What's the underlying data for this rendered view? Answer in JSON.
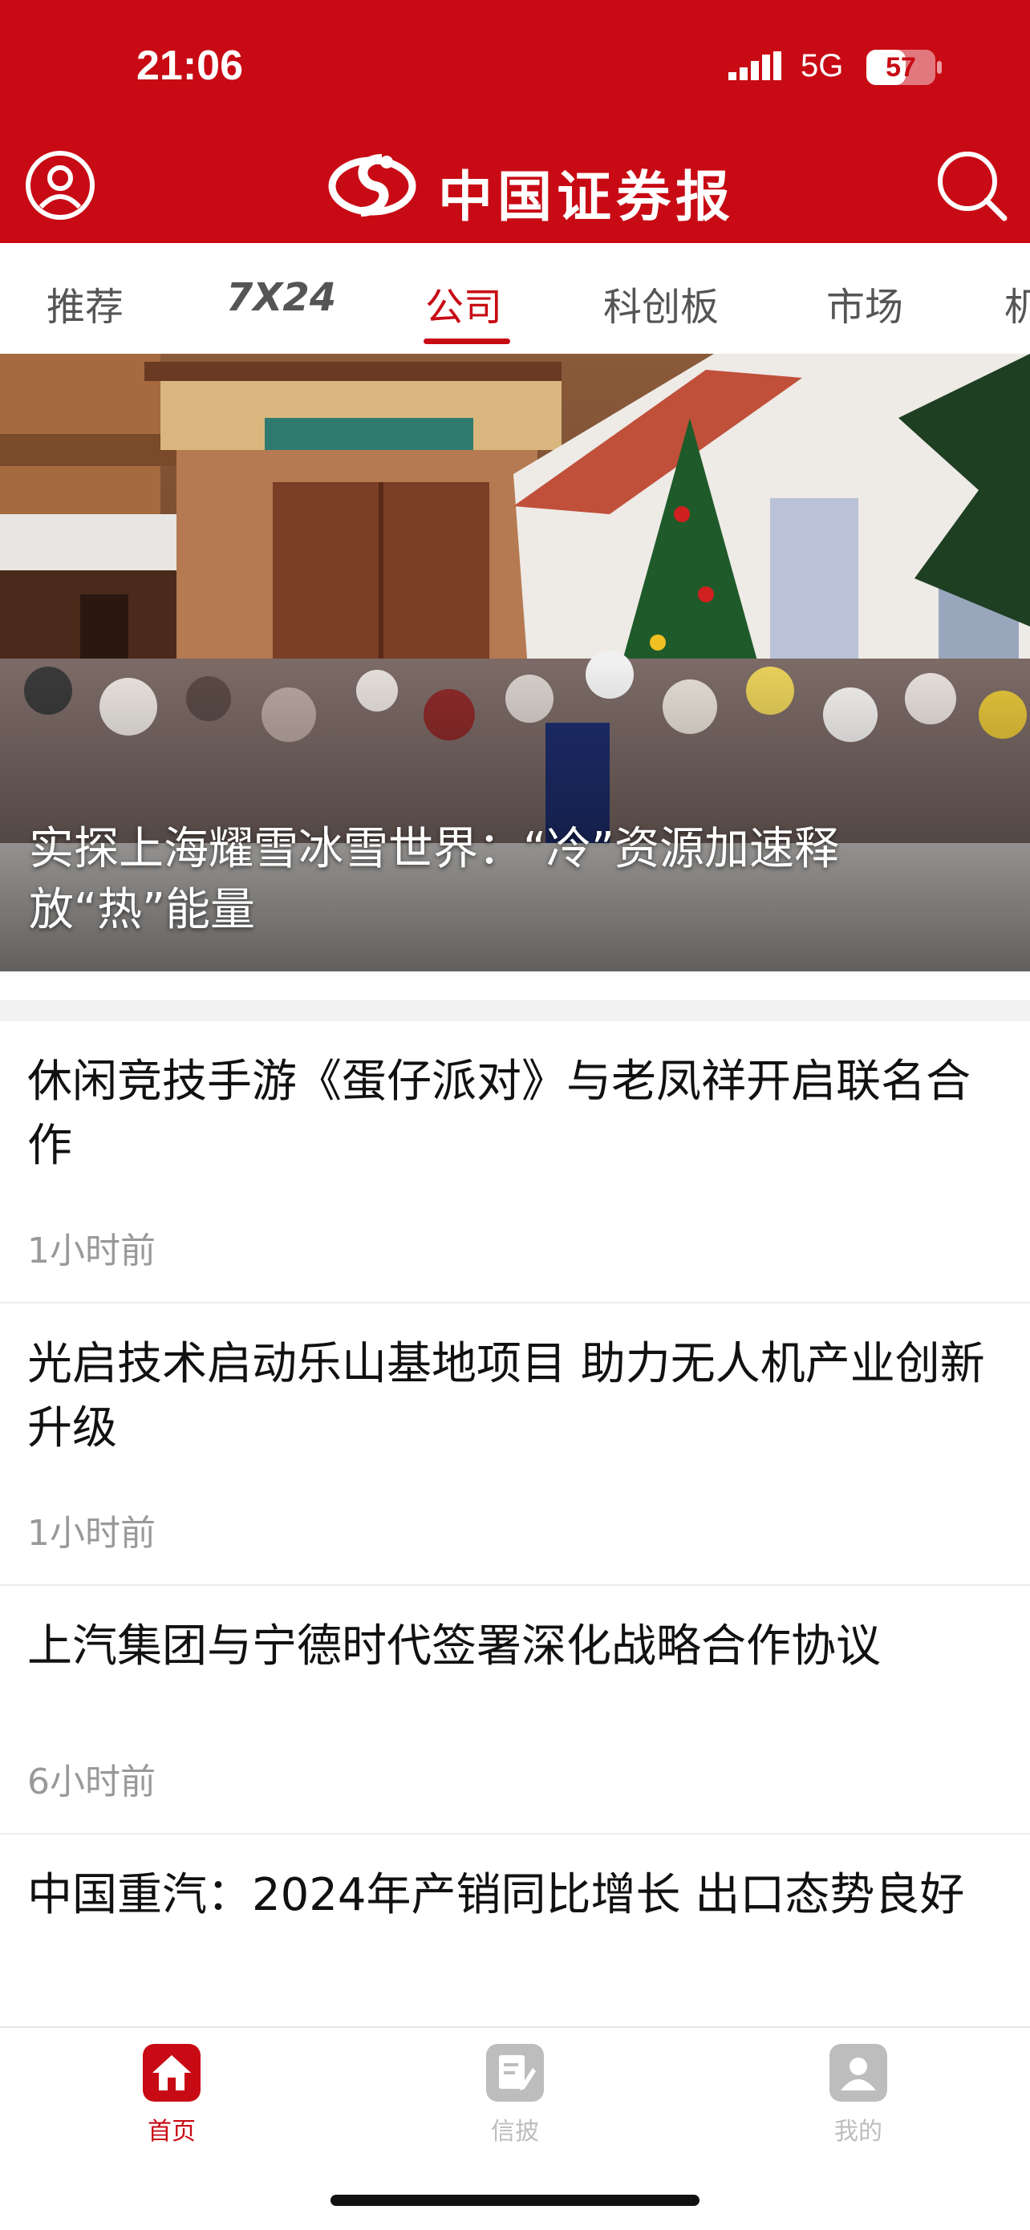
{
  "status_bar": {
    "time": "21:06",
    "network": "5G",
    "battery": "57",
    "battery_level": 0.57
  },
  "header": {
    "logo_text": "中国证券报"
  },
  "tabs": [
    {
      "label": "推荐",
      "active": false
    },
    {
      "label": "7X24",
      "active": false
    },
    {
      "label": "公司",
      "active": true
    },
    {
      "label": "科创板",
      "active": false
    },
    {
      "label": "市场",
      "active": false
    },
    {
      "label": "机",
      "active": false
    }
  ],
  "hero": {
    "title": "实探上海耀雪冰雪世界：“冷”资源加速释放“热”能量"
  },
  "news": [
    {
      "title": "休闲竞技手游《蛋仔派对》与老凤祥开启联名合作",
      "time": "1小时前"
    },
    {
      "title": "光启技术启动乐山基地项目 助力无人机产业创新升级",
      "time": "1小时前"
    },
    {
      "title": "上汽集团与宁德时代签署深化战略合作协议",
      "time": "6小时前"
    },
    {
      "title": "中国重汽：2024年产销同比增长 出口态势良好",
      "time": ""
    }
  ],
  "tabbar": [
    {
      "label": "首页",
      "icon": "home-icon",
      "active": true
    },
    {
      "label": "信披",
      "icon": "edit-document-icon",
      "active": false
    },
    {
      "label": "我的",
      "icon": "person-icon",
      "active": false
    }
  ],
  "colors": {
    "brand_red": "#c80a14",
    "inactive_gray": "#bdbdbd"
  }
}
